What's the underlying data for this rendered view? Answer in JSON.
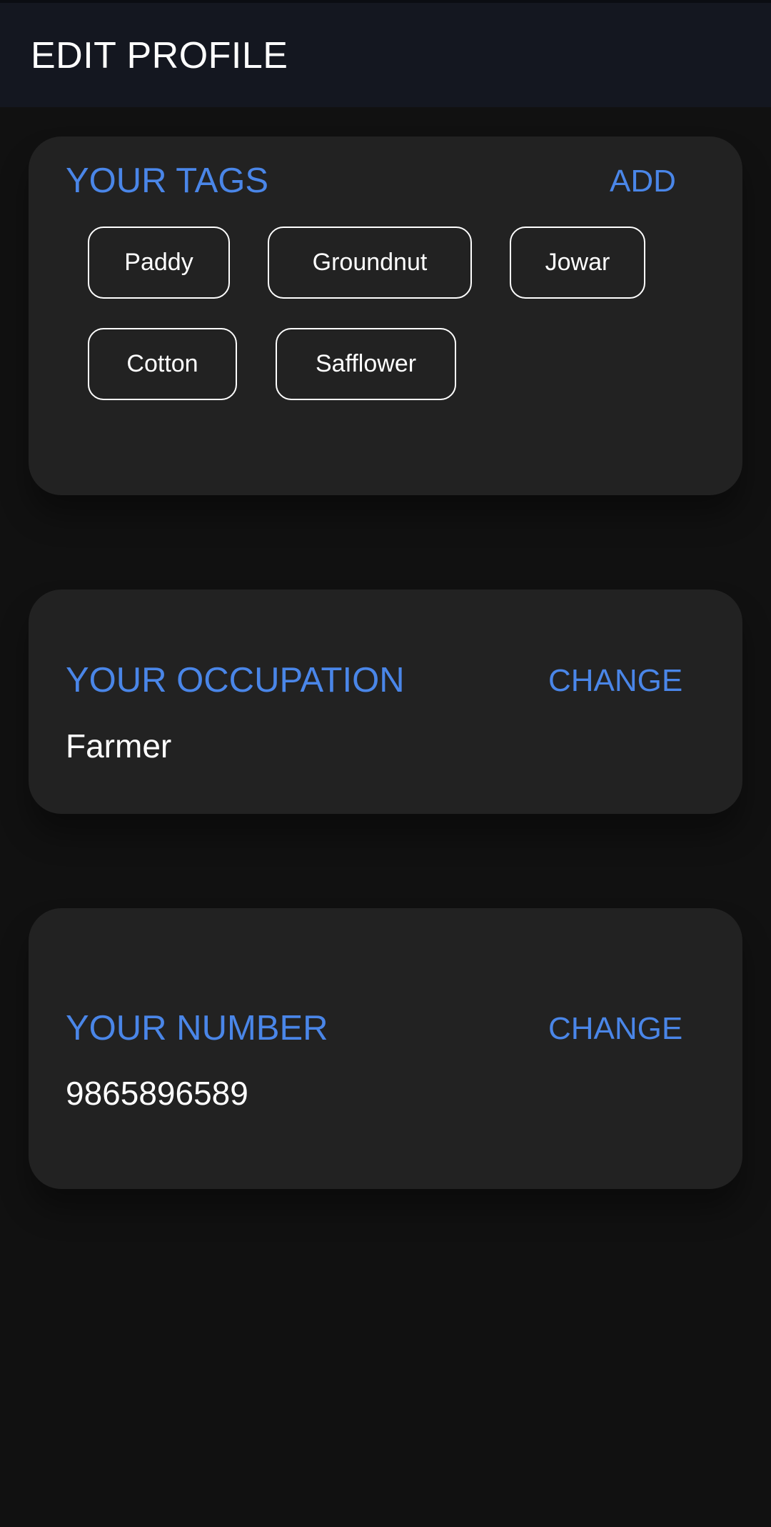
{
  "header": {
    "title": "EDIT PROFILE"
  },
  "tags": {
    "title": "YOUR TAGS",
    "add_label": "ADD",
    "items": [
      "Paddy",
      "Groundnut",
      "Jowar",
      "Cotton",
      "Safflower"
    ]
  },
  "occupation": {
    "title": "YOUR OCCUPATION",
    "change_label": "CHANGE",
    "value": "Farmer"
  },
  "number": {
    "title": "YOUR NUMBER",
    "change_label": "CHANGE",
    "value": "9865896589"
  },
  "colors": {
    "accent": "#4a86e8",
    "card": "#222222",
    "background": "#111111",
    "header": "#141720"
  }
}
